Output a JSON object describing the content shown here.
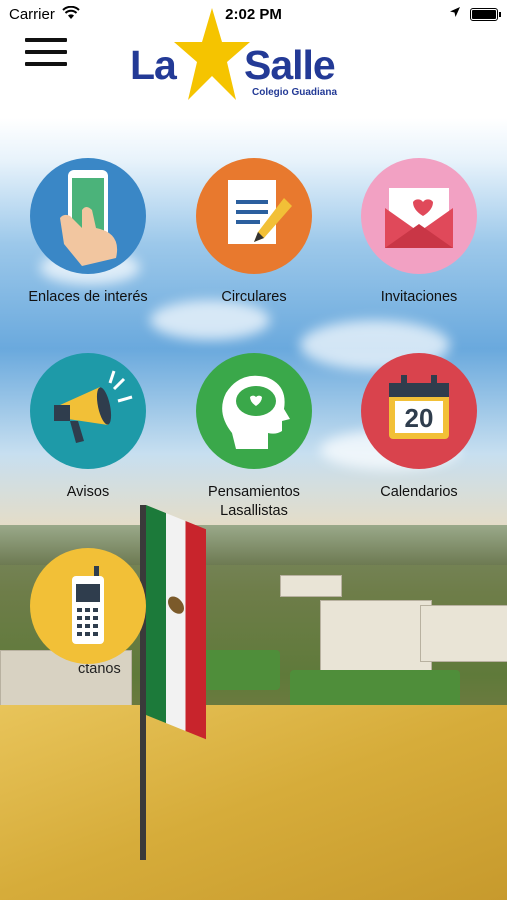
{
  "status_bar": {
    "carrier": "Carrier",
    "time": "2:02 PM"
  },
  "header": {
    "logo_word_left": "La",
    "logo_word_right": "Salle",
    "logo_subtitle": "Colegio Guadiana",
    "brand_blue": "#233a96",
    "brand_star": "#f5c400"
  },
  "menu": {
    "items": [
      {
        "label": "Enlaces de interés",
        "icon": "phone-hand-icon",
        "color": "#3a87c6"
      },
      {
        "label": "Circulares",
        "icon": "document-pencil-icon",
        "color": "#e8792e"
      },
      {
        "label": "Invitaciones",
        "icon": "envelope-heart-icon",
        "color": "#f2a1c3"
      },
      {
        "label": "Avisos",
        "icon": "megaphone-icon",
        "color": "#1e9aa8"
      },
      {
        "label": "Pensamientos Lasallistas",
        "icon": "head-brain-icon",
        "color": "#3aa84a"
      },
      {
        "label": "Calendarios",
        "icon": "calendar-icon",
        "color": "#d9434d",
        "calendar_day": "20"
      },
      {
        "label": "Contactanos",
        "icon": "mobile-phone-icon",
        "color": "#f2c037",
        "label_visible": "ctanos"
      }
    ]
  }
}
